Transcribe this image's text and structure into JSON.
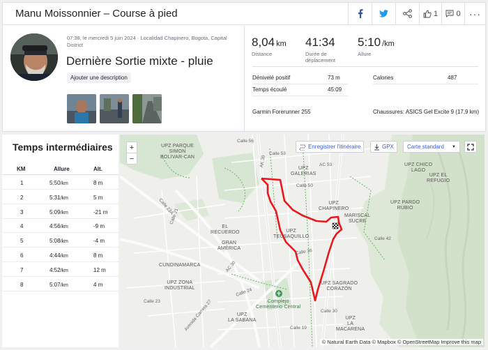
{
  "header": {
    "title": "Manu Moissonnier – Course à pied",
    "kudos_count": "1",
    "comments_count": "0"
  },
  "activity": {
    "meta": "07:38, le mercredi 5 juin 2024 · Localidad Chapinero, Bogota, Capital District",
    "name": "Dernière Sortie mixte - pluie",
    "add_description": "Ajouter une description"
  },
  "stats": {
    "distance": {
      "value": "8,04",
      "unit": "km",
      "label": "Distance"
    },
    "duration": {
      "value": "41:34",
      "label": "Durée de déplacement"
    },
    "pace": {
      "value": "5:10",
      "unit": "/km",
      "label": "Allure"
    },
    "elevation_label": "Dénivelé positif",
    "elevation_value": "73 m",
    "calories_label": "Calories",
    "calories_value": "487",
    "elapsed_label": "Temps écoulé",
    "elapsed_value": "45:09",
    "device": "Garmin Forerunner 255",
    "shoes": "Chaussures: ASICS Gel Excite 9 (17,9 km)"
  },
  "splits": {
    "title": "Temps intermédiaires",
    "headers": [
      "KM",
      "Allure",
      "Alt."
    ],
    "pace_unit": "/km",
    "rows": [
      {
        "km": "1",
        "pace": "5:50",
        "alt": "8 m"
      },
      {
        "km": "2",
        "pace": "5:31",
        "alt": "5 m"
      },
      {
        "km": "3",
        "pace": "5:09",
        "alt": "-21 m"
      },
      {
        "km": "4",
        "pace": "4:56",
        "alt": "-9 m"
      },
      {
        "km": "5",
        "pace": "5:08",
        "alt": "-4 m"
      },
      {
        "km": "6",
        "pace": "4:44",
        "alt": "8 m"
      },
      {
        "km": "7",
        "pace": "4:52",
        "alt": "12 m"
      },
      {
        "km": "8",
        "pace": "5:07",
        "alt": "4 m"
      }
    ]
  },
  "map": {
    "zoom_in": "+",
    "zoom_out": "−",
    "save_route": "Enregistrer l'itinéraire",
    "gpx": "GPX",
    "map_style": "Carte standard",
    "attribution": "© Natural Earth Data © Mapbox © OpenStreetMap Improve this map",
    "labels": {
      "parque": "UPZ PARQUE\nSIMON\nBOLIVAR-CAN",
      "galerias": "UPZ\nGALERIAS",
      "chapinero": "UPZ\nCHAPINERO",
      "chico": "UPZ CHICO\nLAGO",
      "refugio": "UPZ EL\nREFUGIO",
      "pardo": "UPZ PARDO\nRUBIO",
      "mariscal": "MARISCAL\nSUCRE",
      "teusaquillo": "UPZ\nTEUSAQUILLO",
      "recuerdo": "EL\nRECUERDO",
      "gran_america": "GRAN\nAMÉRICA",
      "cundinamarca": "CUNDINAMARCA",
      "zona_ind": "UPZ ZONA\nINDUSTRIAL",
      "sagrado": "UPZ SAGRADO\nCORAZÓN",
      "sabana": "UPZ\nLA SABANA",
      "macarena": "UPZ\nLA\nMACARENA",
      "cementerio": "Complejo\nCementerio Central"
    },
    "streets": {
      "calle56": "Calle 56",
      "calle50": "Calle 50",
      "ac53": "AC 53",
      "ak30": "AK 30",
      "ac30": "AC 30",
      "calle22a": "Calle 22A",
      "calle21": "Calle 21",
      "calle36": "Calle 36",
      "calle30": "Calle 30",
      "calle42": "Calle 42",
      "calle24": "Calle 24",
      "calle19": "Calle 19",
      "carrera27": "Avenida Carrera 27",
      "calle23": "Calle 23",
      "calle53": "Calle 53"
    }
  }
}
